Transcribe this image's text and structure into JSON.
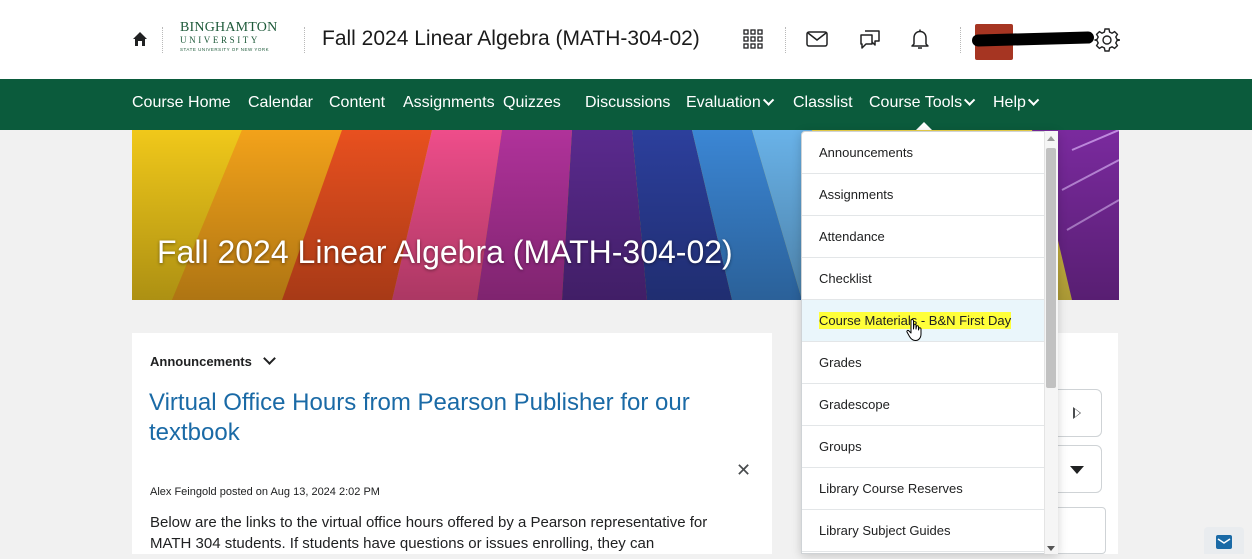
{
  "header": {
    "logo": {
      "line1": "BINGHAMTON",
      "line2": "UNIVERSITY",
      "line3": "STATE UNIVERSITY OF NEW YORK"
    },
    "course_title": "Fall 2024 Linear Algebra (MATH-304-02)",
    "icons": [
      "home-icon",
      "waffle-grid-icon",
      "mail-icon",
      "chat-icon",
      "bell-icon",
      "avatar",
      "gear-icon"
    ]
  },
  "nav": {
    "items": [
      {
        "label": "Course Home"
      },
      {
        "label": "Calendar"
      },
      {
        "label": "Content"
      },
      {
        "label": "Assignments"
      },
      {
        "label": "Quizzes"
      },
      {
        "label": "Discussions"
      },
      {
        "label": "Evaluation",
        "has_dropdown": true
      },
      {
        "label": "Classlist"
      },
      {
        "label": "Course Tools",
        "has_dropdown": true,
        "open": true
      },
      {
        "label": "Help",
        "has_dropdown": true
      }
    ]
  },
  "banner": {
    "title": "Fall 2024 Linear Algebra (MATH-304-02)"
  },
  "announcements": {
    "label": "Announcements",
    "title": "Virtual Office Hours from Pearson Publisher for our textbook",
    "posted": "Alex Feingold posted on Aug 13, 2024 2:02 PM",
    "body": "Below are the links to the virtual office hours offered by a Pearson representative for MATH 304 students. If students have questions or issues enrolling, they can"
  },
  "course_tools_menu": {
    "items": [
      {
        "label": "Announcements"
      },
      {
        "label": "Assignments"
      },
      {
        "label": "Attendance"
      },
      {
        "label": "Checklist"
      },
      {
        "label": "Course Materials - B&N First Day",
        "highlighted": true
      },
      {
        "label": "Grades"
      },
      {
        "label": "Gradescope"
      },
      {
        "label": "Groups"
      },
      {
        "label": "Library Course Reserves"
      },
      {
        "label": "Library Subject Guides"
      }
    ]
  },
  "colors": {
    "nav_green": "#0b5b3c",
    "link_blue": "#1a6aa6",
    "highlight_yellow": "#ffff3a",
    "avatar_red": "#a63522"
  }
}
